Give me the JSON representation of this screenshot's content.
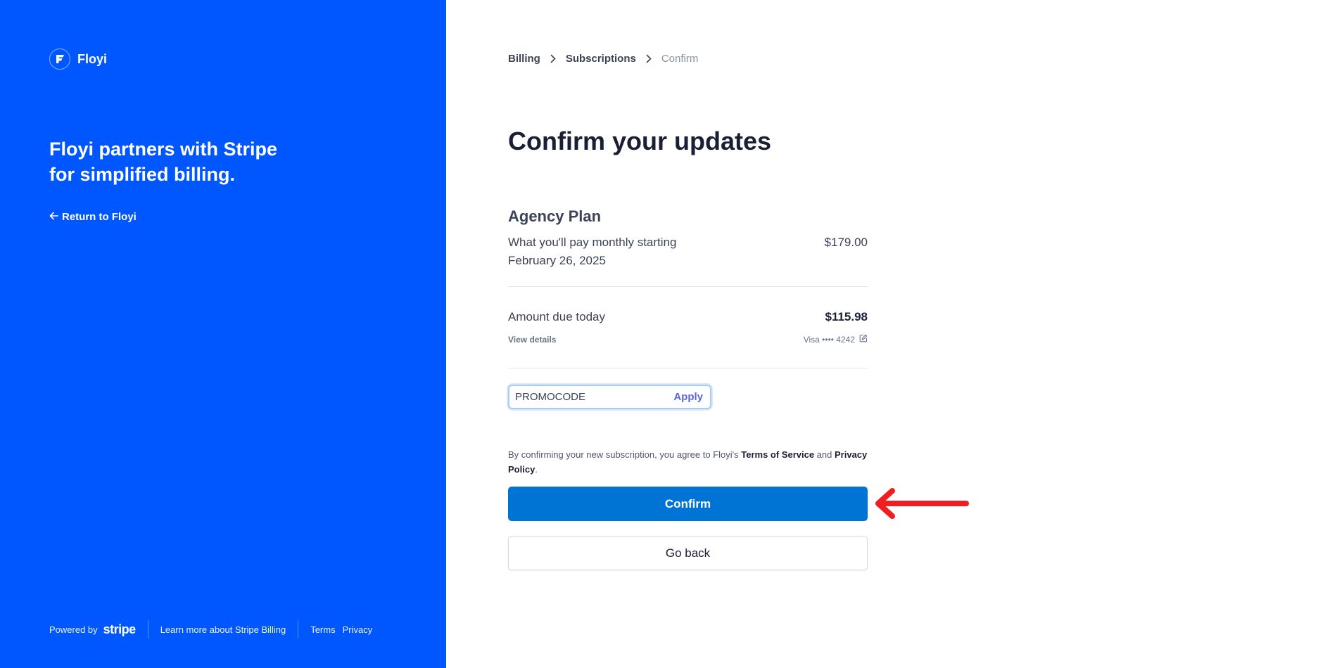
{
  "brand": {
    "name": "Floyi"
  },
  "left_panel": {
    "headline_line1": "Floyi partners with Stripe",
    "headline_line2": "for simplified billing.",
    "return_label": "Return to Floyi",
    "footer": {
      "powered_by": "Powered by",
      "stripe": "stripe",
      "learn_more": "Learn more about Stripe Billing",
      "terms": "Terms",
      "privacy": "Privacy"
    },
    "background_color": "#0057ff"
  },
  "breadcrumb": {
    "items": [
      "Billing",
      "Subscriptions"
    ],
    "current": "Confirm"
  },
  "page_title": "Confirm your updates",
  "plan": {
    "name": "Agency Plan",
    "description_line1": "What you'll pay monthly starting",
    "description_line2": "February 26, 2025",
    "price": "$179.00"
  },
  "due": {
    "label": "Amount due today",
    "amount": "$115.98",
    "view_details": "View details",
    "card": "Visa •••• 4242"
  },
  "promo": {
    "value": "PROMOCODE",
    "apply_label": "Apply"
  },
  "legal": {
    "prefix": "By confirming your new subscription, you agree to Floyi's ",
    "terms": "Terms of Service",
    "and": " and ",
    "privacy": "Privacy Policy",
    "suffix": "."
  },
  "actions": {
    "confirm": "Confirm",
    "go_back": "Go back"
  },
  "colors": {
    "confirm_button": "#0074d4",
    "annotation_arrow": "#f01e1e"
  },
  "icons": [
    "floyi-logo-icon",
    "arrow-left-icon",
    "chevron-right-icon",
    "edit-icon",
    "annotation-arrow-icon"
  ]
}
